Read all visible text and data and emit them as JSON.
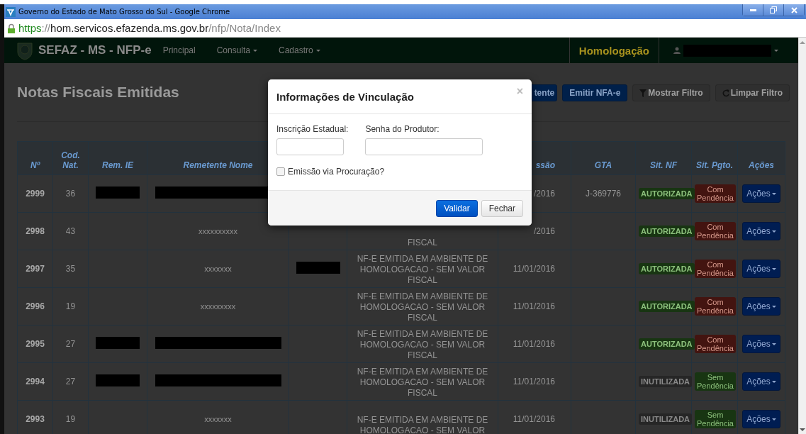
{
  "window": {
    "title": "Governo do Estado de Mato Grosso do Sul - Google Chrome"
  },
  "address_bar": {
    "scheme": "https",
    "separator": "://",
    "host": "hom.servicos.efazenda.ms.gov.br",
    "path": "/nfp/Nota/Index"
  },
  "navbar": {
    "brand": "SEFAZ - MS - NFP-e",
    "menu": [
      {
        "label": "Principal",
        "dropdown": false
      },
      {
        "label": "Consulta",
        "dropdown": true
      },
      {
        "label": "Cadastro",
        "dropdown": true
      }
    ],
    "environment": "Homologação",
    "user_redacted": true
  },
  "page": {
    "title": "Notas Fiscais Emitidas",
    "toolbar": [
      {
        "label": "tente",
        "kind": "primary"
      },
      {
        "label": "Emitir NFA-e",
        "kind": "primary"
      },
      {
        "label": "Mostrar Filtro",
        "kind": "filter"
      },
      {
        "label": "Limpar Filtro",
        "kind": "refresh"
      }
    ]
  },
  "table": {
    "columns": [
      "Nº",
      "Cod. Nat.",
      "Rem. IE",
      "Remetente Nome",
      "",
      "",
      "ssão",
      "GTA",
      "Sit. NF",
      "Sit. Pgto.",
      "Ações"
    ],
    "rows": [
      {
        "numero": "2999",
        "cod_nat": "36",
        "rem_ie_redacted": true,
        "remetente_nome": "",
        "remetente_nome_redacted": true,
        "column_5_redacted": false,
        "column_6": "",
        "emissao": "/2016",
        "gta": "J-369776",
        "sit_nf": {
          "label": "AUTORIZADA",
          "kind": "success"
        },
        "sit_pgto": {
          "label": "Com Pendência",
          "kind": "danger"
        },
        "acoes": "Ações"
      },
      {
        "numero": "2998",
        "cod_nat": "43",
        "rem_ie_redacted": false,
        "remetente_nome": "xxxxxxxxxx",
        "remetente_nome_redacted": false,
        "column_5_redacted": false,
        "column_6": "FISCAL",
        "emissao": "/2016",
        "gta": "",
        "sit_nf": {
          "label": "AUTORIZADA",
          "kind": "success"
        },
        "sit_pgto": {
          "label": "Com Pendência",
          "kind": "danger"
        },
        "acoes": "Ações"
      },
      {
        "numero": "2997",
        "cod_nat": "35",
        "rem_ie_redacted": false,
        "remetente_nome": "xxxxxxx",
        "remetente_nome_redacted": false,
        "column_5_redacted": true,
        "column_6": "NF-E EMITIDA EM AMBIENTE DE HOMOLOGACAO - SEM VALOR FISCAL",
        "emissao": "11/01/2016",
        "gta": "",
        "sit_nf": {
          "label": "AUTORIZADA",
          "kind": "success"
        },
        "sit_pgto": {
          "label": "Com Pendência",
          "kind": "danger"
        },
        "acoes": "Ações"
      },
      {
        "numero": "2996",
        "cod_nat": "19",
        "rem_ie_redacted": false,
        "remetente_nome": "xxxxxxxxx",
        "remetente_nome_redacted": false,
        "column_5_redacted": false,
        "column_6": "NF-E EMITIDA EM AMBIENTE DE HOMOLOGACAO - SEM VALOR FISCAL",
        "emissao": "11/01/2016",
        "gta": "",
        "sit_nf": {
          "label": "AUTORIZADA",
          "kind": "success"
        },
        "sit_pgto": {
          "label": "Com Pendência",
          "kind": "danger"
        },
        "acoes": "Ações"
      },
      {
        "numero": "2995",
        "cod_nat": "27",
        "rem_ie_redacted": true,
        "remetente_nome": "",
        "remetente_nome_redacted": true,
        "column_5_redacted": false,
        "column_6": "NF-E EMITIDA EM AMBIENTE DE HOMOLOGACAO - SEM VALOR FISCAL",
        "emissao": "11/01/2016",
        "gta": "",
        "sit_nf": {
          "label": "AUTORIZADA",
          "kind": "success"
        },
        "sit_pgto": {
          "label": "Com Pendência",
          "kind": "danger"
        },
        "acoes": "Ações"
      },
      {
        "numero": "2994",
        "cod_nat": "27",
        "rem_ie_redacted": true,
        "remetente_nome": "",
        "remetente_nome_redacted": true,
        "column_5_redacted": false,
        "column_6": "NF-E EMITIDA EM AMBIENTE DE HOMOLOGACAO - SEM VALOR FISCAL",
        "emissao": "11/01/2016",
        "gta": "",
        "sit_nf": {
          "label": "INUTILIZADA",
          "kind": "inverse"
        },
        "sit_pgto": {
          "label": "Sem Pendência",
          "kind": "success"
        },
        "acoes": "Ações"
      },
      {
        "numero": "2993",
        "cod_nat": "19",
        "rem_ie_redacted": false,
        "remetente_nome": "xxxxxxx",
        "remetente_nome_redacted": false,
        "column_5_redacted": false,
        "column_6": "NF-E EMITIDA EM AMBIENTE DE HOMOLOGACAO - SEM VALOR",
        "emissao": "11/01/2016",
        "gta": "",
        "sit_nf": {
          "label": "INUTILIZADA",
          "kind": "inverse"
        },
        "sit_pgto": {
          "label": "Sem Pendência",
          "kind": "success"
        },
        "acoes": "Ações"
      }
    ]
  },
  "modal": {
    "title": "Informações de Vinculação",
    "close": "×",
    "fields": [
      {
        "label": "Inscrição Estadual:"
      },
      {
        "label": "Senha do Produtor:"
      }
    ],
    "checkbox": {
      "label": "Emissão via Procuração?",
      "checked": false
    },
    "buttons": [
      {
        "label": "Validar",
        "kind": "primary"
      },
      {
        "label": "Fechar",
        "kind": "default"
      }
    ]
  }
}
